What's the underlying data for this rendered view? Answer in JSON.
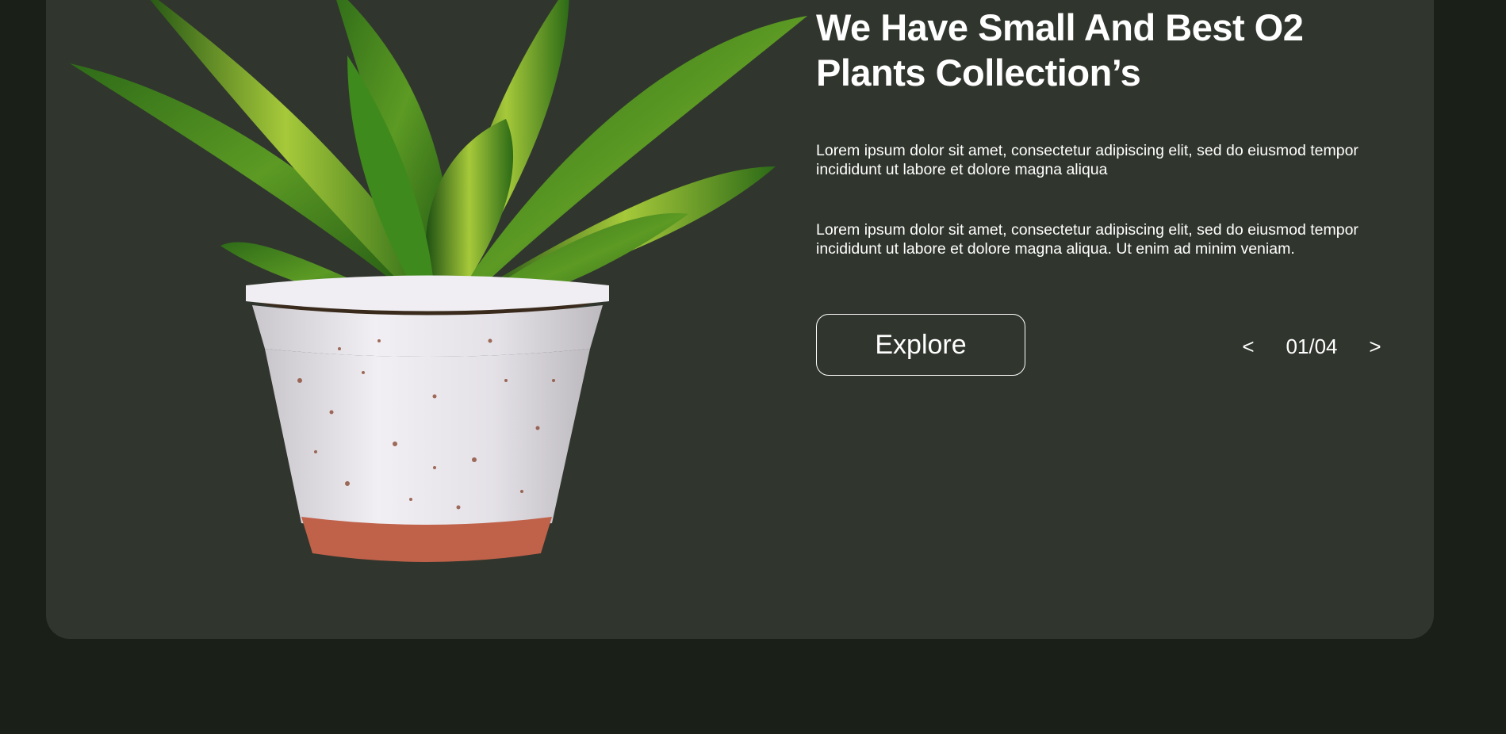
{
  "hero": {
    "title_line1": "We Have Small And Best O2",
    "title_line2": "Plants Collection’s",
    "paragraph1": "Lorem ipsum dolor sit amet, consectetur adipiscing elit, sed do eiusmod tempor incididunt ut labore et dolore magna aliqua",
    "paragraph2": "Lorem ipsum dolor sit amet, consectetur adipiscing elit, sed do eiusmod tempor incididunt ut labore et dolore magna aliqua. Ut enim ad minim veniam.",
    "explore_label": "Explore",
    "pager": {
      "prev_label": "<",
      "counter": "01/04",
      "next_label": ">"
    }
  },
  "colors": {
    "page_bg": "#1a2017",
    "card_bg": "#30362d",
    "text": "#ffffff",
    "pot_body": "#e7e4ea",
    "pot_base": "#c0614a"
  },
  "icons": {
    "plant_image": "potted-plant-illustration"
  }
}
